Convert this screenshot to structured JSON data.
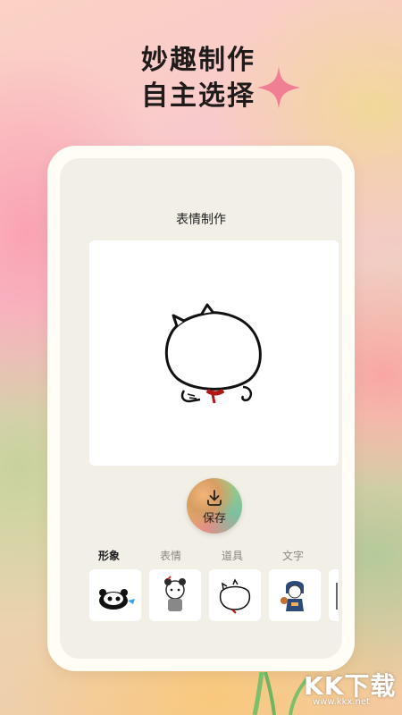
{
  "hero": {
    "line1": "妙趣制作",
    "line2": "自主选择"
  },
  "editor": {
    "title": "表情制作",
    "save_label": "保存"
  },
  "tabs": [
    {
      "label": "形象",
      "active": true
    },
    {
      "label": "表情",
      "active": false
    },
    {
      "label": "道具",
      "active": false
    },
    {
      "label": "文字",
      "active": false
    }
  ],
  "thumbnails": [
    {
      "icon": "panda-sticker"
    },
    {
      "icon": "girl-sticker"
    },
    {
      "icon": "cat-sticker"
    },
    {
      "icon": "hooded-figure-sticker"
    },
    {
      "icon": "partial-sticker"
    }
  ],
  "watermark": {
    "main": "KK下载",
    "sub": "www.kkx.net"
  },
  "colors": {
    "accent_star": "#f07f94",
    "card_bg": "#fffdf6",
    "inner_bg": "#f1efe6"
  }
}
